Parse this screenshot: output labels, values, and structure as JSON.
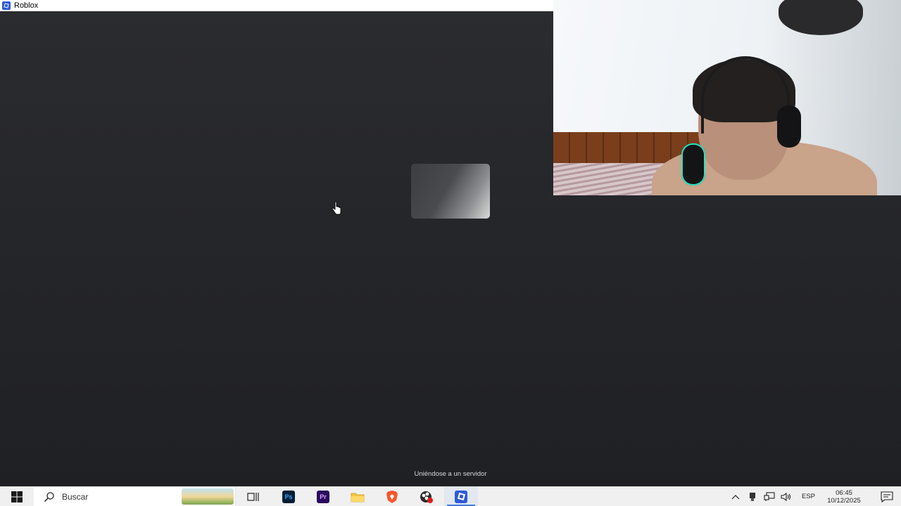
{
  "window": {
    "title": "Roblox",
    "icon": "roblox-icon"
  },
  "game": {
    "status_text": "Uniéndose a un servidor",
    "loading_placeholder": "loading-thumbnail"
  },
  "webcam": {
    "description": "webcam-feed"
  },
  "taskbar": {
    "search_placeholder": "Buscar",
    "apps": [
      {
        "name": "task-view-icon"
      },
      {
        "name": "photoshop-icon",
        "label": "Ps"
      },
      {
        "name": "premiere-icon",
        "label": "Pr"
      },
      {
        "name": "file-explorer-icon"
      },
      {
        "name": "brave-icon"
      },
      {
        "name": "obs-icon"
      },
      {
        "name": "roblox-icon"
      }
    ],
    "tray": {
      "language": "ESP",
      "time": "06:45",
      "date": "10/12/2025"
    }
  },
  "colors": {
    "taskbar_bg": "#f0f0f0",
    "roblox_blue": "#2e5bd8",
    "photoshop_blue": "#001e36",
    "premiere_purple": "#2a0a5e",
    "brave_orange": "#fb542b",
    "active_indicator": "#3b7bdc"
  }
}
